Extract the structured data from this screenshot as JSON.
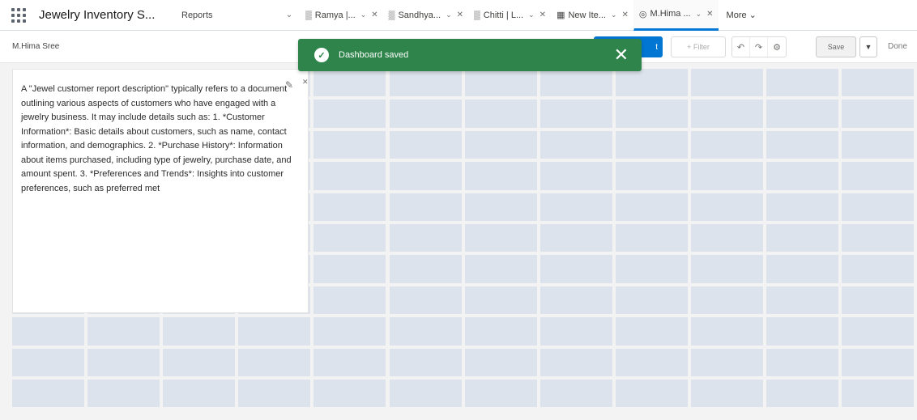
{
  "app": {
    "name": "Jewelry Inventory S..."
  },
  "nav": {
    "reports_label": "Reports",
    "tabs": [
      {
        "icon": "report-icon",
        "glyph": "▒",
        "label": "Ramya |..."
      },
      {
        "icon": "report-icon",
        "glyph": "▒",
        "label": "Sandhya..."
      },
      {
        "icon": "report-icon",
        "glyph": "▒",
        "label": "Chitti | L..."
      },
      {
        "icon": "dashboard-icon",
        "glyph": "▦",
        "label": "New Ite..."
      },
      {
        "icon": "dashboard-icon",
        "glyph": "◎",
        "label": "M.Hima ..."
      }
    ],
    "more_label": "More"
  },
  "dashboard": {
    "title": "M.Hima Sree",
    "add_label": "t",
    "filter_label": "+ Filter",
    "save_label": "Save",
    "done_label": "Done"
  },
  "widget": {
    "text": "A \"Jewel customer report description\" typically refers to a document outlining various aspects of customers who have engaged with a jewelry business. It may include details such as: 1. *Customer Information*: Basic details about customers, such as name, contact information, and demographics. 2. *Purchase History*: Information about items purchased, including type of jewelry, purchase date, and amount spent. 3. *Preferences and Trends*: Insights into customer preferences, such as preferred met"
  },
  "toast": {
    "message": "Dashboard saved"
  },
  "colors": {
    "accent": "#0176d3",
    "toast": "#2e844a",
    "grid_cell": "#dde3ec"
  }
}
